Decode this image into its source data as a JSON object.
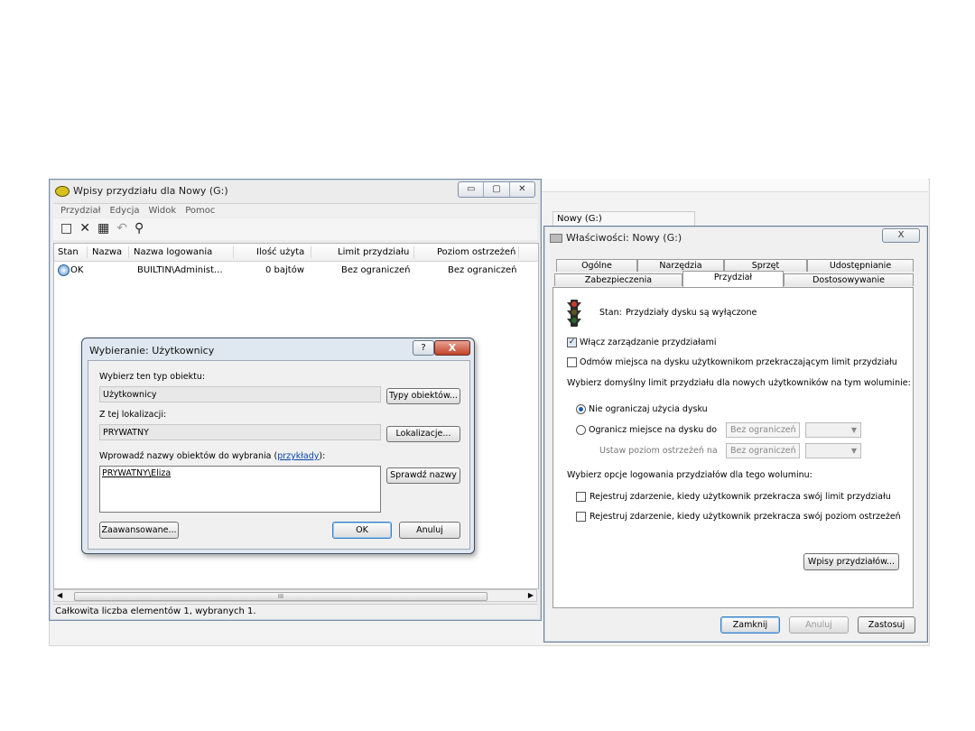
{
  "background": {
    "tab_label": "Nowy (G:)"
  },
  "quota_window": {
    "title": "Wpisy przydziału dla Nowy (G:)",
    "window_controls": [
      "▭",
      "▢",
      "✕"
    ],
    "menu": [
      "Przydział",
      "Edycja",
      "Widok",
      "Pomoc"
    ],
    "toolbar_icons": [
      "new-entry-icon",
      "delete-icon",
      "properties-icon",
      "undo-icon",
      "find-icon"
    ],
    "columns": [
      "Stan",
      "Nazwa",
      "Nazwa logowania",
      "Ilość użyta",
      "Limit przydziału",
      "Poziom ostrzeżeń"
    ],
    "rows": [
      {
        "status": "OK",
        "name": "",
        "login": "BUILTIN\\Administ...",
        "used": "0 bajtów",
        "limit": "Bez ograniczeń",
        "warning": "Bez ograniczeń"
      }
    ],
    "scroll_thumb_text": "III",
    "statusbar": "Całkowita liczba elementów 1, wybranych 1."
  },
  "select_dialog": {
    "title": "Wybieranie: Użytkownicy",
    "help_label": "?",
    "close_label": "X",
    "object_type_label": "Wybierz ten typ obiektu:",
    "object_type_value": "Użytkownicy",
    "object_types_button": "Typy obiektów...",
    "location_label": "Z tej lokalizacji:",
    "location_value": "PRYWATNY",
    "locations_button": "Lokalizacje...",
    "names_label_prefix": "Wprowadź nazwy obiektów do wybrania (",
    "names_label_link": "przykłady",
    "names_label_suffix": "):",
    "names_value": "PRYWATNY\\Eliza",
    "check_names_button": "Sprawdź nazwy",
    "advanced_button": "Zaawansowane...",
    "ok_button": "OK",
    "cancel_button": "Anuluj"
  },
  "properties_window": {
    "title": "Właściwości: Nowy (G:)",
    "close_label": "X",
    "tabs_row1": [
      "Ogólne",
      "Narzędzia",
      "Sprzęt",
      "Udostępnianie"
    ],
    "tabs_row2": [
      "Zabezpieczenia",
      "Przydział",
      "Dostosowywanie"
    ],
    "active_tab": "Przydział",
    "status_label": "Stan:",
    "status_value": "Przydziały dysku są wyłączone",
    "enable_quota": {
      "label": "Włącz zarządzanie przydziałami",
      "checked": true
    },
    "deny_space": {
      "label": "Odmów miejsca na dysku użytkownikom przekraczającym limit przydziału",
      "checked": false
    },
    "default_limit_heading": "Wybierz domyślny limit przydziału dla nowych użytkowników na tym woluminie:",
    "no_limit_radio": {
      "label": "Nie ograniczaj użycia dysku",
      "selected": true
    },
    "limit_radio": {
      "label": "Ogranicz miejsce na dysku do",
      "selected": false
    },
    "limit_value": "Bez ograniczeń",
    "warning_label": "Ustaw poziom ostrzeżeń na",
    "warning_value": "Bez ograniczeń",
    "logging_heading": "Wybierz opcje logowania przydziałów dla tego woluminu:",
    "log_limit": {
      "label": "Rejestruj zdarzenie, kiedy użytkownik przekracza swój limit przydziału",
      "checked": false
    },
    "log_warning": {
      "label": "Rejestruj zdarzenie, kiedy użytkownik przekracza swój poziom ostrzeżeń",
      "checked": false
    },
    "quota_entries_button": "Wpisy przydziałów...",
    "close_button": "Zamknij",
    "cancel_button": "Anuluj",
    "apply_button": "Zastosuj"
  }
}
